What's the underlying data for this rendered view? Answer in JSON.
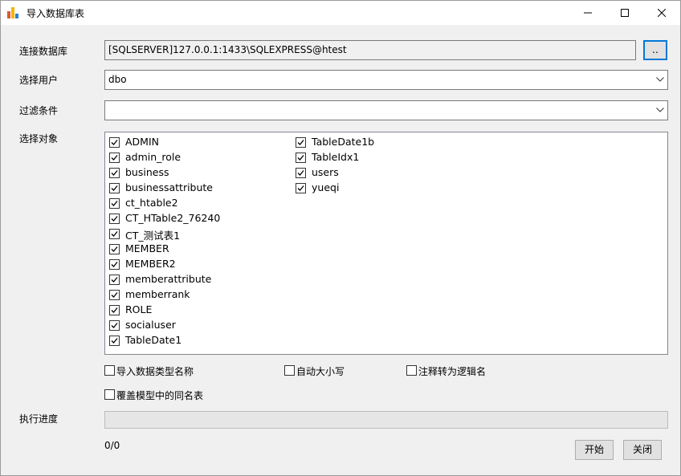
{
  "window": {
    "title": "导入数据库表",
    "controls": {
      "minimize": "minimize",
      "maximize": "maximize",
      "close": "close"
    }
  },
  "form": {
    "connection_label": "连接数据库",
    "connection_value": "[SQLSERVER]127.0.0.1:1433\\SQLEXPRESS@htest",
    "browse_label": "..",
    "user_label": "选择用户",
    "user_value": "dbo",
    "filter_label": "过滤条件",
    "filter_value": "",
    "objects_label": "选择对象"
  },
  "objects": {
    "column1": [
      {
        "name": "ADMIN",
        "checked": true
      },
      {
        "name": "admin_role",
        "checked": true
      },
      {
        "name": "business",
        "checked": true
      },
      {
        "name": "businessattribute",
        "checked": true
      },
      {
        "name": "ct_htable2",
        "checked": true
      },
      {
        "name": "CT_HTable2_76240",
        "checked": true
      },
      {
        "name": "CT_测试表1",
        "checked": true
      },
      {
        "name": "MEMBER",
        "checked": true
      },
      {
        "name": "MEMBER2",
        "checked": true
      },
      {
        "name": "memberattribute",
        "checked": true
      },
      {
        "name": "memberrank",
        "checked": true
      },
      {
        "name": "ROLE",
        "checked": true
      },
      {
        "name": "socialuser",
        "checked": true
      },
      {
        "name": "TableDate1",
        "checked": true
      }
    ],
    "column2": [
      {
        "name": "TableDate1b",
        "checked": true
      },
      {
        "name": "TableIdx1",
        "checked": true
      },
      {
        "name": "users",
        "checked": true
      },
      {
        "name": "yueqi",
        "checked": true
      }
    ]
  },
  "options": {
    "import_type_names": "导入数据类型名称",
    "auto_case": "自动大小写",
    "comment_to_logical": "注释转为逻辑名",
    "overwrite_same_name": "覆盖模型中的同名表"
  },
  "progress": {
    "label": "执行进度",
    "count": "0/0",
    "fraction": 0
  },
  "buttons": {
    "start": "开始",
    "close": "关闭"
  }
}
